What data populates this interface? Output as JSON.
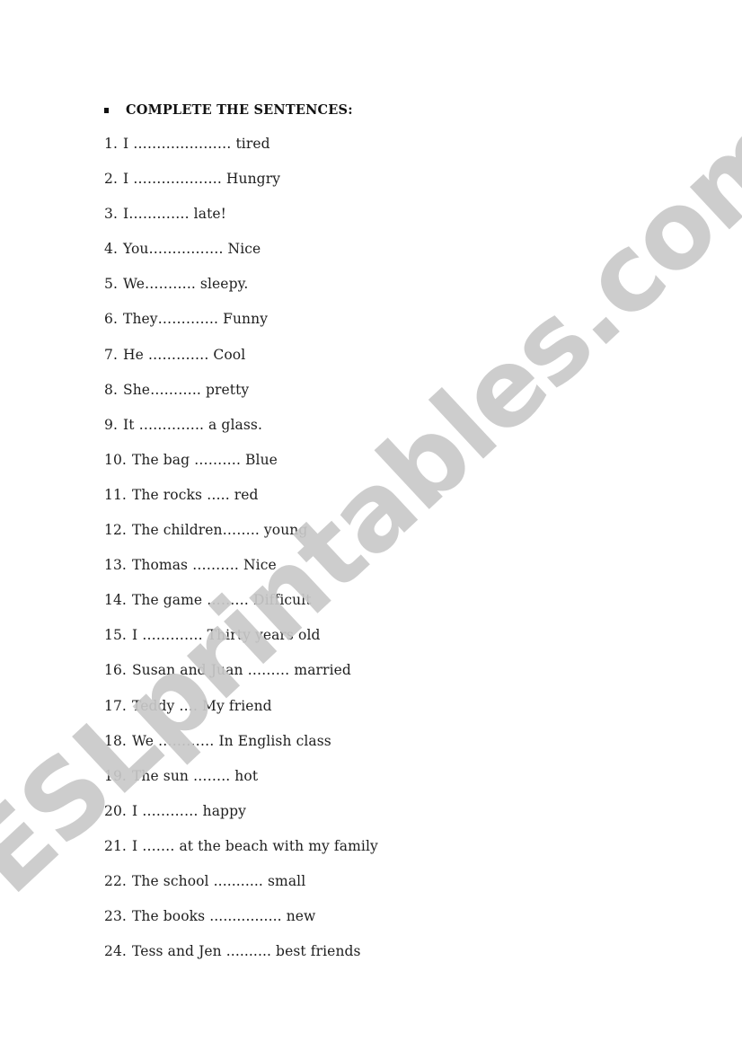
{
  "heading": {
    "bullet_icon": "square-bullet",
    "text": "COMPLETE THE SENTENCES:"
  },
  "sentences": [
    {
      "number": "1.",
      "text": "I ………………… tired"
    },
    {
      "number": "2.",
      "text": "I ………………. Hungry"
    },
    {
      "number": "3.",
      "text": "I…………. late!"
    },
    {
      "number": "4.",
      "text": "You……………. Nice"
    },
    {
      "number": "5.",
      "text": "We……….. sleepy."
    },
    {
      "number": "6.",
      "text": "They…………. Funny"
    },
    {
      "number": "7.",
      "text": "He …………. Cool"
    },
    {
      "number": "8.",
      "text": "She……….. pretty"
    },
    {
      "number": "9.",
      "text": "It ………….. a glass."
    },
    {
      "number": "10.",
      "text": "The bag ………. Blue"
    },
    {
      "number": "11.",
      "text": "The rocks ….. red"
    },
    {
      "number": "12.",
      "text": "The children…….. young"
    },
    {
      "number": "13.",
      "text": "Thomas ………. Nice"
    },
    {
      "number": "14.",
      "text": "The game ……… Difficult"
    },
    {
      "number": "15.",
      "text": "I …………. Thirty years old"
    },
    {
      "number": "16.",
      "text": "Susan and Juan ……… married"
    },
    {
      "number": "17.",
      "text": "Teddy …. My friend"
    },
    {
      "number": "18.",
      "text": "We ………… In English class"
    },
    {
      "number": "19.",
      "text": "The sun …….. hot"
    },
    {
      "number": "20.",
      "text": "I ………… happy"
    },
    {
      "number": "21.",
      "text": "I ……. at the beach with my family"
    },
    {
      "number": "22.",
      "text": "The school ........... small"
    },
    {
      "number": "23.",
      "text": "The books ................ new"
    },
    {
      "number": "24.",
      "text": "Tess and Jen .......... best friends"
    }
  ],
  "watermark": {
    "text": "ESLprintables.com",
    "color": "#c9c9c9"
  }
}
